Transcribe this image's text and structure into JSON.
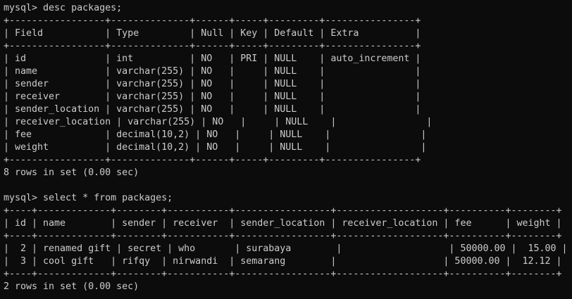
{
  "terminal": {
    "lines": [
      "mysql> desc packages;",
      "+-----------------+--------------+------+-----+---------+----------------+",
      "| Field           | Type         | Null | Key | Default | Extra          |",
      "+-----------------+--------------+------+-----+---------+----------------+",
      "| id              | int          | NO   | PRI | NULL    | auto_increment |",
      "| name            | varchar(255) | NO   |     | NULL    |                |",
      "| sender          | varchar(255) | NO   |     | NULL    |                |",
      "| receiver        | varchar(255) | NO   |     | NULL    |                |",
      "| sender_location | varchar(255) | NO   |     | NULL    |                |",
      "| receiver_location | varchar(255) | NO   |     | NULL    |                |",
      "| fee             | decimal(10,2) | NO   |     | NULL    |                |",
      "| weight          | decimal(10,2) | NO   |     | NULL    |                |",
      "+-----------------+--------------+------+-----+---------+----------------+",
      "8 rows in set (0.00 sec)",
      "",
      "mysql> select * from packages;",
      "+----+-------------+--------+-----------+-----------------+-------------------+----------+--------+",
      "| id | name        | sender | receiver  | sender_location | receiver_location | fee      | weight |",
      "+----+-------------+--------+-----------+-----------------+-------------------+----------+--------+",
      "|  2 | renamed gift | secret | who       | surabaya        |                   | 50000.00 |  15.00 |",
      "|  3 | cool gift   | rifqy  | nirwandi  | semarang        |                   | 50000.00 |  12.12 |",
      "+----+-------------+--------+-----------+-----------------+-------------------+----------+--------+",
      "2 rows in set (0.00 sec)"
    ]
  }
}
